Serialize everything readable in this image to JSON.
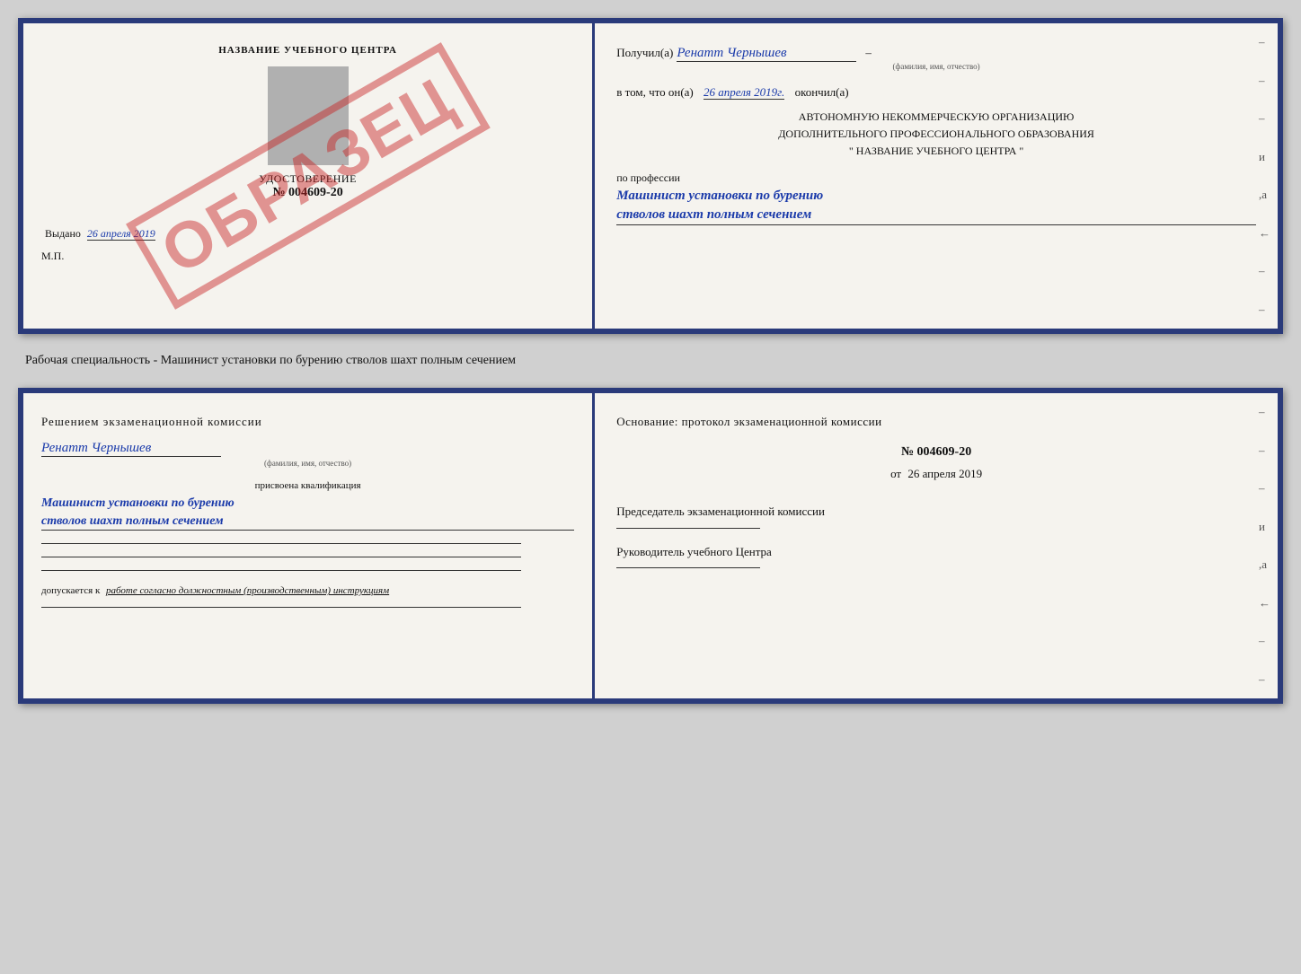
{
  "page": {
    "background": "#d0d0d0"
  },
  "booklet1": {
    "left": {
      "title": "НАЗВАНИЕ УЧЕБНОГО ЦЕНТРА",
      "stamp": "ОБРАЗЕЦ",
      "udostovTitle": "УДОСТОВЕРЕНИЕ",
      "number": "№ 004609-20",
      "issued_label": "Выдано",
      "issued_date": "26 апреля 2019",
      "mp": "М.П."
    },
    "right": {
      "received_label": "Получил(а)",
      "received_name": "Ренатт Чернышев",
      "received_sub": "(фамилия, имя, отчество)",
      "dash": "–",
      "vtom_label": "в том, что он(а)",
      "vtom_date": "26 апреля 2019г.",
      "okoncil": "окончил(а)",
      "org_line1": "АВТОНОМНУЮ НЕКОММЕРЧЕСКУЮ ОРГАНИЗАЦИЮ",
      "org_line2": "ДОПОЛНИТЕЛЬНОГО ПРОФЕССИОНАЛЬНОГО ОБРАЗОВАНИЯ",
      "org_line3": "\"   НАЗВАНИЕ УЧЕБНОГО ЦЕНТРА   \"",
      "prof_label": "по профессии",
      "prof_name1": "Машинист установки по бурению",
      "prof_name2": "стволов шахт полным сечением"
    }
  },
  "between": {
    "text": "Рабочая специальность - Машинист установки по бурению стволов шахт полным сечением"
  },
  "booklet2": {
    "left": {
      "decision_title": "Решением экзаменационной комиссии",
      "person_name": "Ренатт Чернышев",
      "person_sub": "(фамилия, имя, отчество)",
      "qual_label": "присвоена квалификация",
      "qual_name1": "Машинист установки по бурению",
      "qual_name2": "стволов шахт полным сечением",
      "допуск_label": "допускается к",
      "допуск_text": "работе согласно должностным (производственным) инструкциям"
    },
    "right": {
      "osnov_title": "Основание: протокол экзаменационной комиссии",
      "protocol_num": "№  004609-20",
      "protocol_date_label": "от",
      "protocol_date": "26 апреля 2019",
      "chairman_label": "Председатель экзаменационной комиссии",
      "руководитель_label": "Руководитель учебного Центра"
    }
  }
}
